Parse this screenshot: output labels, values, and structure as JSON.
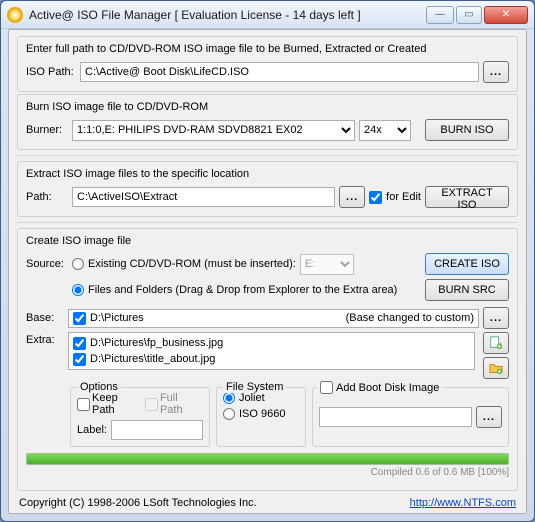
{
  "window": {
    "title": "Active@ ISO File Manager [ Evaluation License - 14 days left ]"
  },
  "path_section": {
    "heading": "Enter full path to CD/DVD-ROM ISO image file to be Burned, Extracted or Created",
    "label": "ISO Path:",
    "value": "C:\\Active@ Boot Disk\\LifeCD.ISO",
    "browse": "..."
  },
  "burn_section": {
    "heading": "Burn ISO image file to CD/DVD-ROM",
    "label": "Burner:",
    "device": "1:1:0,E: PHILIPS  DVD-RAM SDVD8821 EX02",
    "speed": "24x",
    "button": "BURN ISO"
  },
  "extract_section": {
    "heading": "Extract ISO image files to the specific location",
    "label": "Path:",
    "value": "C:\\ActiveISO\\Extract",
    "browse": "...",
    "for_edit": "for Edit",
    "button": "EXTRACT ISO"
  },
  "create_section": {
    "heading": "Create ISO image file",
    "source_label": "Source:",
    "opt_cd": "Existing CD/DVD-ROM (must be inserted):",
    "drive": "E:",
    "create_btn": "CREATE ISO",
    "opt_files": "Files and Folders (Drag & Drop from Explorer to the Extra area)",
    "burn_src_btn": "BURN SRC",
    "base_label": "Base:",
    "base_value": "D:\\Pictures",
    "base_note": "(Base changed to custom)",
    "base_browse": "...",
    "extra_label": "Extra:",
    "extra_items": [
      "D:\\Pictures\\fp_business.jpg",
      "D:\\Pictures\\title_about.jpg"
    ],
    "options": {
      "title": "Options",
      "keep_path": "Keep Path",
      "full_path": "Full Path",
      "label_label": "Label:",
      "label_value": ""
    },
    "fs": {
      "title": "File System",
      "joliet": "Joliet",
      "iso9660": "ISO 9660"
    },
    "boot": {
      "title": "Add Boot Disk Image",
      "browse": "..."
    }
  },
  "progress": {
    "text": "Compiled  0.6 of  0.6 MB  [100%]"
  },
  "footer": {
    "copyright": "Copyright (C) 1998-2006 LSoft Technologies Inc.",
    "link": "http://www.NTFS.com"
  }
}
